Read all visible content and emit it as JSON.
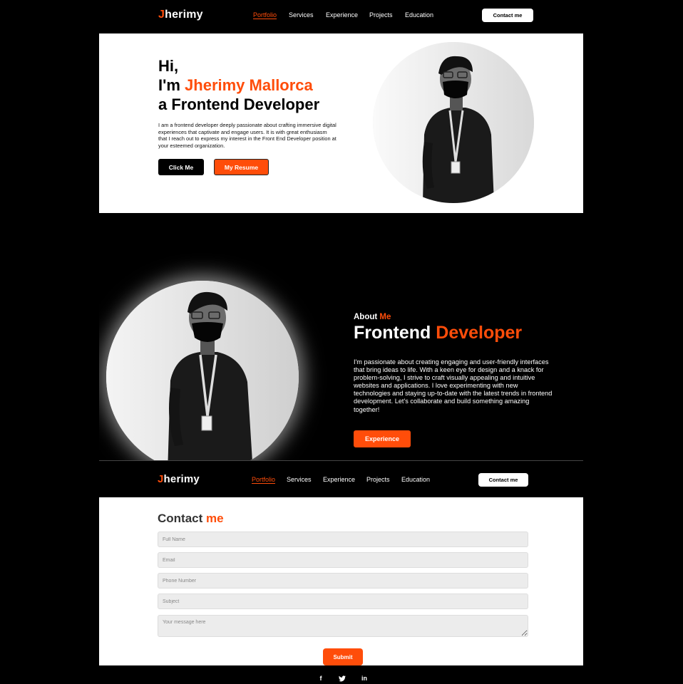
{
  "brand": {
    "first_letter": "J",
    "rest": "herimy"
  },
  "nav": {
    "links": [
      "Portfolio",
      "Services",
      "Experience",
      "Projects",
      "Education"
    ],
    "contact_label": "Contact me"
  },
  "hero": {
    "line1": "Hi,",
    "line2_prefix": "I'm ",
    "line2_name": "Jherimy Mallorca",
    "line3": "a Frontend Developer",
    "paragraph": "I am a frontend developer deeply passionate about crafting immersive digital experiences that captivate and engage users. It is with great enthusiasm that I reach out to express my interest in the Front End Developer position at your esteemed organization.",
    "btn_primary": "Click Me",
    "btn_resume": "My Resume"
  },
  "about": {
    "label_prefix": "About ",
    "label_accent": "Me",
    "title_prefix": "Frontend ",
    "title_accent": "Developer",
    "paragraph": "I'm passionate about creating engaging and user-friendly interfaces that bring ideas to life. With a keen eye for design and a knack for problem-solving, I strive to craft visually appealing and intuitive websites and applications. I love experimenting with new technologies and staying up-to-date with the latest trends in frontend development. Let's collaborate and build something amazing together!",
    "btn_experience": "Experience"
  },
  "contact": {
    "title_prefix": "Contact ",
    "title_accent": "me",
    "placeholders": {
      "full_name": "Full Name",
      "email": "Email",
      "phone": "Phone Number",
      "subject": "Subject",
      "message": "Your message here"
    },
    "submit_label": "Submit"
  },
  "footer": {
    "social_icons": [
      "facebook-icon",
      "twitter-icon",
      "linkedin-icon"
    ],
    "facebook_glyph": "f",
    "linkedin_glyph": "in"
  },
  "colors": {
    "accent": "#ff4d0a",
    "dark": "#000000",
    "light": "#ffffff",
    "field_bg": "#ececec"
  }
}
